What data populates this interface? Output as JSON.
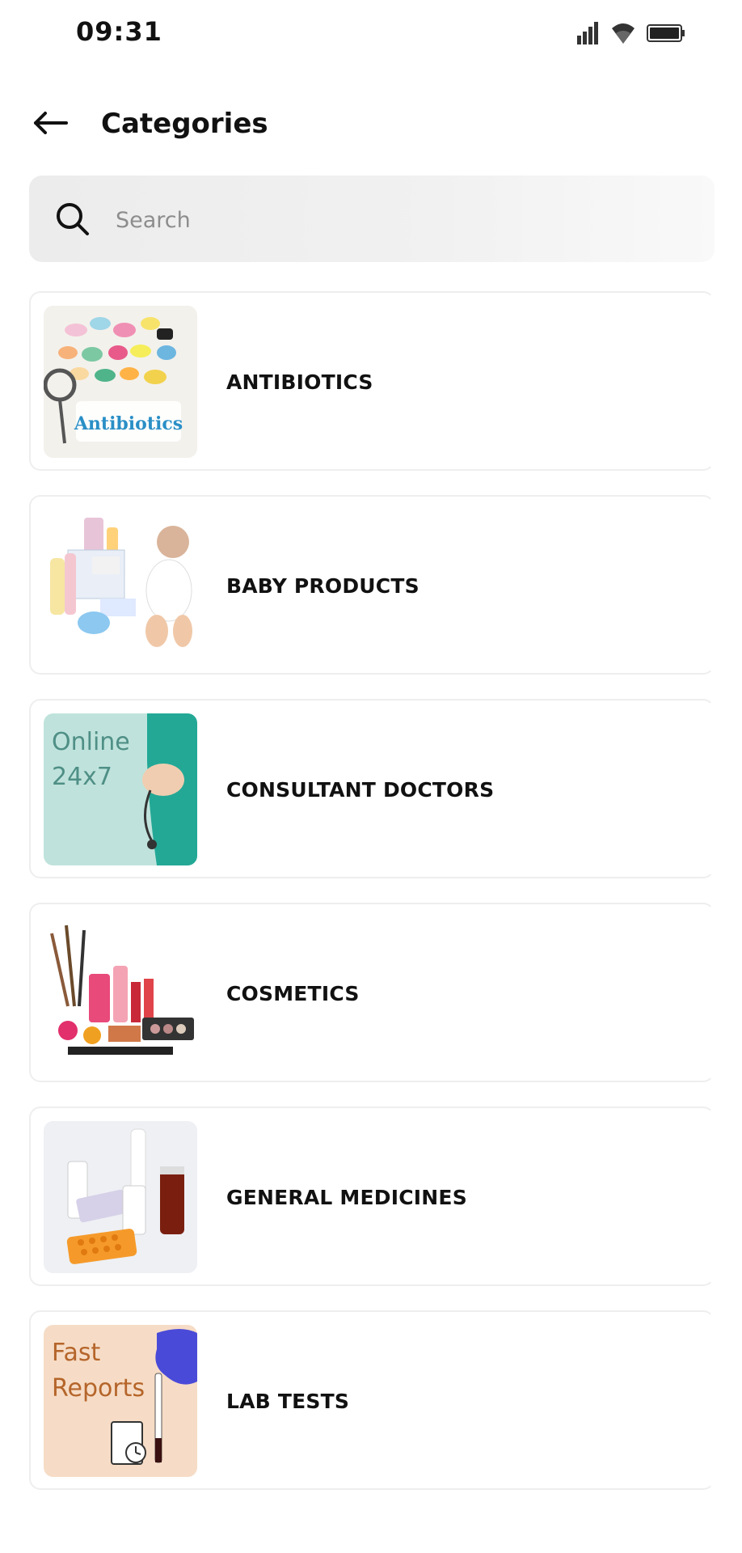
{
  "status_bar": {
    "time": "09:31",
    "icons": [
      "signal-icon",
      "wifi-icon",
      "battery-icon"
    ]
  },
  "header": {
    "title": "Categories",
    "back_icon": "arrow-left-icon"
  },
  "search": {
    "placeholder": "Search",
    "value": "",
    "icon": "search-icon"
  },
  "categories": [
    {
      "label": "ANTIBIOTICS",
      "thumb_text": "Antibiotics"
    },
    {
      "label": "BABY PRODUCTS"
    },
    {
      "label": "CONSULTANT DOCTORS",
      "thumb_text_1": "Online",
      "thumb_text_2": "24x7"
    },
    {
      "label": "COSMETICS"
    },
    {
      "label": "GENERAL MEDICINES"
    },
    {
      "label": "LAB TESTS",
      "thumb_text_1": "Fast",
      "thumb_text_2": "Reports"
    }
  ],
  "colors": {
    "card_border": "#eeeeee",
    "search_bg": "#ececec",
    "doctor_thumb_bg": "#bfe3dc",
    "lab_thumb_bg": "#f6dcc6",
    "lab_text": "#b5652a"
  }
}
